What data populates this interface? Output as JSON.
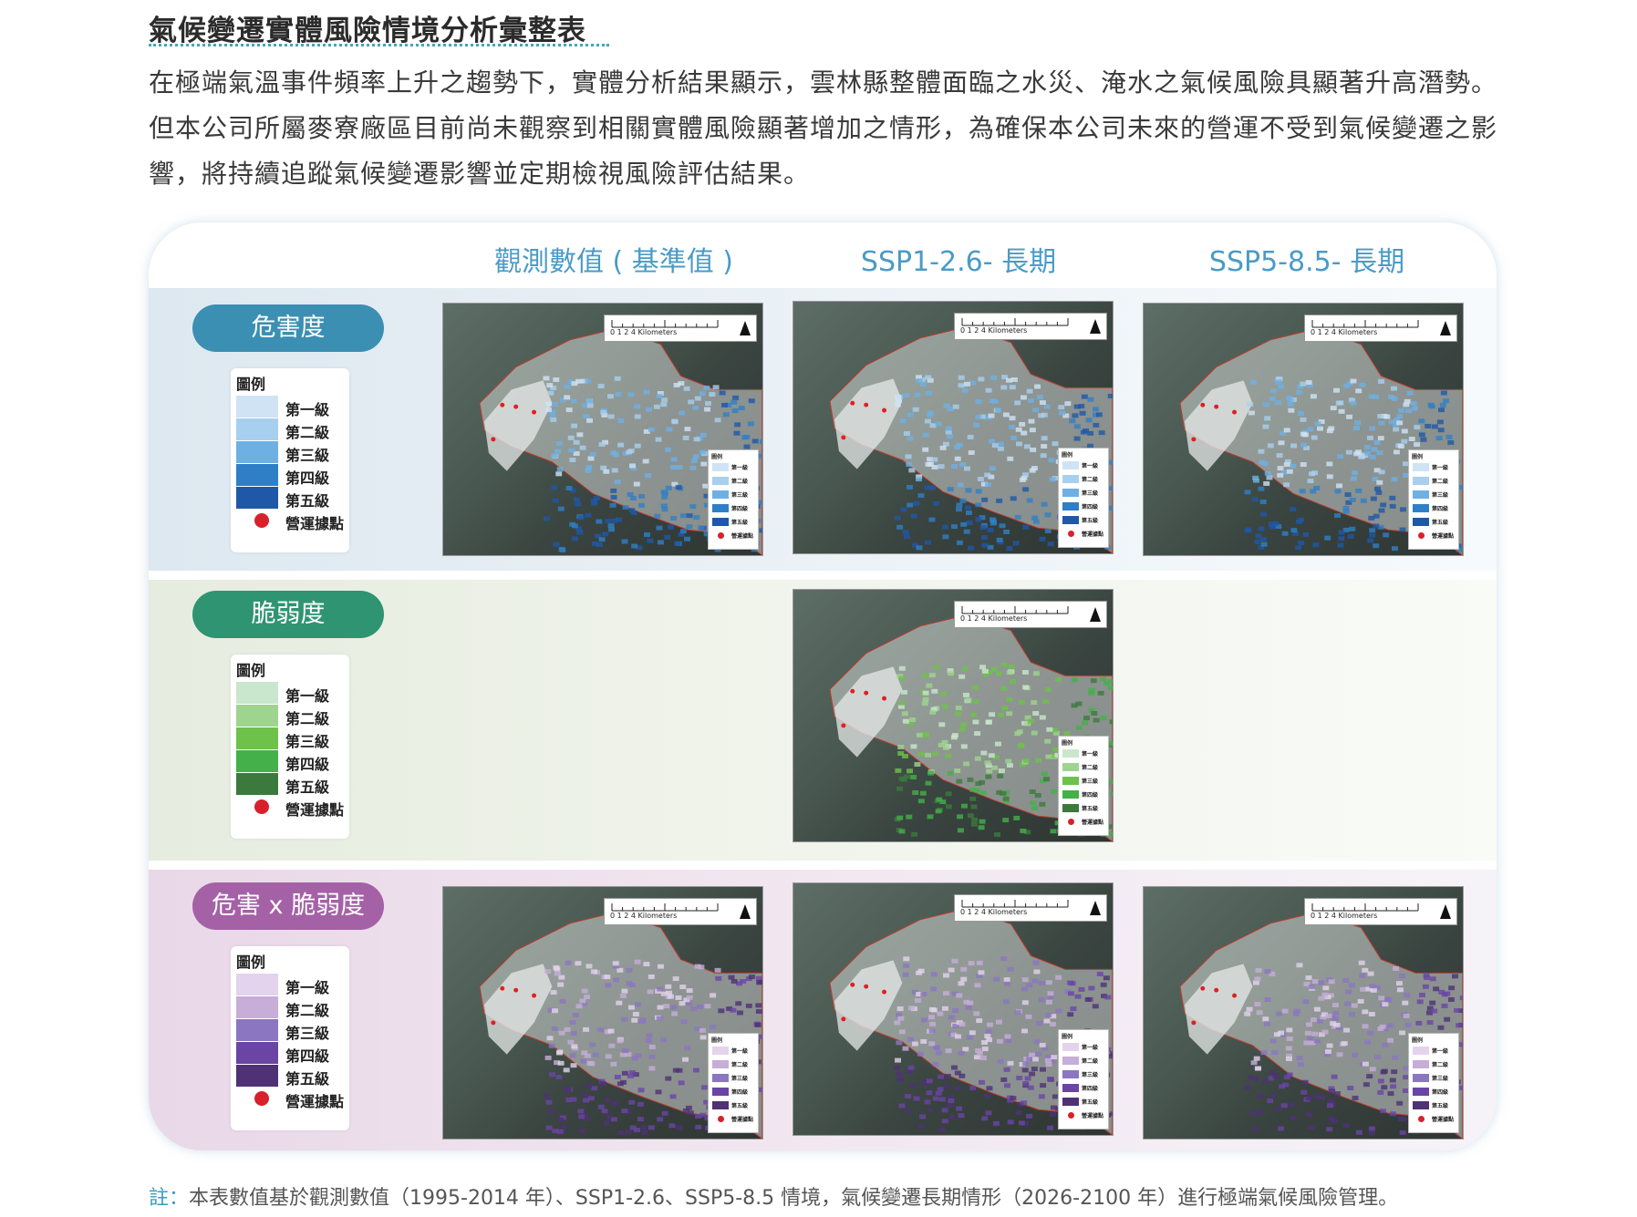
{
  "heading": "氣候變遷實體風險情境分析彙整表",
  "intro": "在極端氣溫事件頻率上升之趨勢下，實體分析結果顯示，雲林縣整體面臨之水災、淹水之氣候風險具顯著升高潛勢。但本公司所屬麥寮廠區目前尚未觀察到相關實體風險顯著增加之情形，為確保本公司未來的營運不受到氣候變遷之影響，將持續追蹤氣候變遷影響並定期檢視風險評估結果。",
  "columns": [
    "觀測數值 ( 基準值 )",
    "SSP1-2.6- 長期",
    "SSP5-8.5- 長期"
  ],
  "legend_common": {
    "title": "圖例",
    "levels": [
      "第一級",
      "第二級",
      "第三級",
      "第四級",
      "第五級"
    ],
    "site": "營運據點"
  },
  "rows": [
    {
      "label": "危害度",
      "colors": [
        "#cfe3f5",
        "#a7d0ef",
        "#6fb0e3",
        "#2f7fc6",
        "#1f58a8"
      ]
    },
    {
      "label": "脆弱度",
      "colors": [
        "#c9e7cd",
        "#9fd48f",
        "#6ec24a",
        "#44b04a",
        "#3b7a3c"
      ]
    },
    {
      "label": "危害 x 脆弱度",
      "colors": [
        "#e3d3ec",
        "#c6aed8",
        "#8b76c2",
        "#6a45a6",
        "#4e3275"
      ]
    }
  ],
  "map_scale": {
    "ticks": "0   1   2",
    "unit": "4 Kilometers"
  },
  "note": {
    "prefix": "註：",
    "text": "本表數值基於觀測數值（1995-2014 年）、SSP1-2.6、SSP5-8.5 情境，氣候變遷長期情形（2026-2100 年）進行極端氣候風險管理。"
  }
}
